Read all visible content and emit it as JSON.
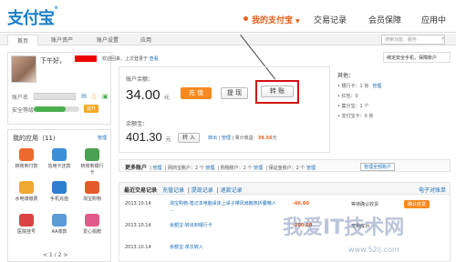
{
  "logo": {
    "text": "支付宝",
    "reg": "®"
  },
  "topnav": {
    "my_alipay": "我的支付宝",
    "transactions": "交易记录",
    "membership": "会员保障",
    "apps": "应用中"
  },
  "subnav": {
    "tabs": [
      "首页",
      "账户资产",
      "账户设置",
      "应用"
    ],
    "search_placeholder": "搜索功能、服务"
  },
  "user": {
    "greeting": "下午好，",
    "last_login_prefix": "欢迎回来，上次登录于",
    "last_login_link": "查看",
    "account_label": "账户名",
    "security_label": "安全等级",
    "security_level": 0.7,
    "security_btn": "提升"
  },
  "apps": {
    "title": "我的应用（11）",
    "manage": "管理",
    "items": [
      {
        "label": "转账到付款",
        "color": "#e96a2c"
      },
      {
        "label": "信用卡还款",
        "color": "#3b8fd6"
      },
      {
        "label": "转账到银行卡",
        "color": "#4aa152"
      },
      {
        "label": "水电煤缴费",
        "color": "#f0a830"
      },
      {
        "label": "手机充值",
        "color": "#2f7fd0"
      },
      {
        "label": "淘宝购物",
        "color": "#e65b2c"
      },
      {
        "label": "医院挂号",
        "color": "#d94343"
      },
      {
        "label": "AA收款",
        "color": "#5a9bd8"
      },
      {
        "label": "爱心捐赠",
        "color": "#e25a8a"
      }
    ],
    "pager": "< 1 / 2 >"
  },
  "balance": {
    "label": "账户余额：",
    "amount": "34.00",
    "unit": "元",
    "recharge": "充 值",
    "withdraw": "提 现",
    "transfer": "转 账"
  },
  "yuebao": {
    "label": "余额宝：",
    "amount": "401.30",
    "unit": "元",
    "transfer_in": "转 入",
    "transfer_out": "转出",
    "manage": "管理",
    "income_label": "累计收益：",
    "income": "39.56",
    "income_unit": "元"
  },
  "others": {
    "title": "其他：",
    "rows": [
      {
        "label": "银行卡：1 张",
        "link": "管理"
      },
      {
        "label": "红包：0",
        "link": ""
      },
      {
        "label": "集分宝：1 个",
        "link": ""
      },
      {
        "label": "支付宝卡：0 张",
        "link": ""
      }
    ]
  },
  "phone_card": "绑定安全手机，保障账户",
  "more_accounts": {
    "title": "更多账户",
    "items": [
      "管理",
      "网商宝账户：2 个",
      "购物账户：2 个",
      "保证金账户：2 个"
    ],
    "manage_all": "管理全部账户"
  },
  "transactions": {
    "title": "最近交易记录",
    "tabs": [
      "充值记录",
      "提现记录",
      "退款记录"
    ],
    "bill": "电子对账单",
    "rows": [
      {
        "date": "2013.10.14",
        "desc": "淘宝购物-笔记本电脑桌床上桌子带风扇散热折叠懒人 ...",
        "amount": "-66.00",
        "status": "等待确认收货",
        "action": "确认收货",
        "amount_color": "#e6601c"
      },
      {
        "date": "2013.10.14",
        "desc": "余额宝-转出到银行卡",
        "amount": "-100.00",
        "status": "交易成功",
        "action": "",
        "amount_color": "#e6601c"
      },
      {
        "date": "2013.10.14",
        "desc": "余额宝-单次转入",
        "amount": "",
        "status": "",
        "action": "",
        "amount_color": "#e6601c"
      }
    ]
  },
  "watermark": {
    "main": "我爱IT技术网",
    "sub": "www.52ij.com"
  }
}
